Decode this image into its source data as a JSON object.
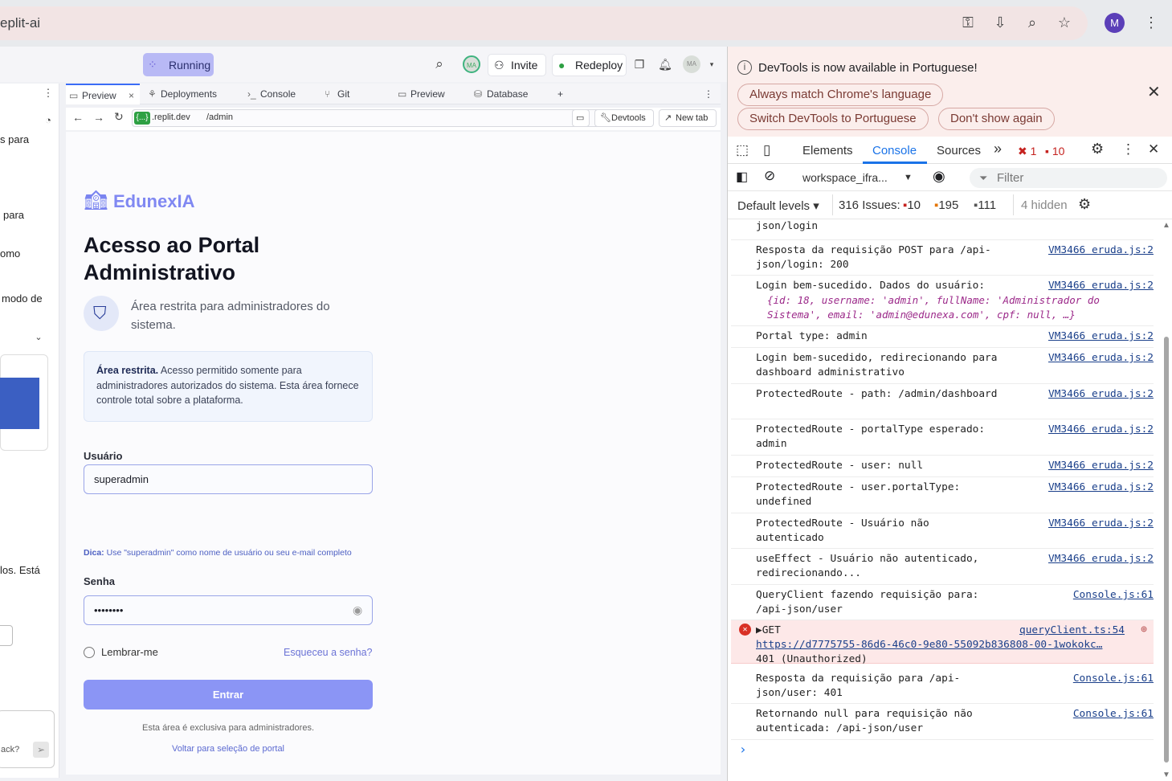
{
  "browser": {
    "url_fragment": "eplit-ai",
    "profile_initial": "M",
    "icons": [
      "key-icon",
      "install-icon",
      "zoom-icon",
      "star-icon",
      "menu-dots-icon"
    ]
  },
  "replit": {
    "status_label": "Running",
    "invite_label": "Invite",
    "redeploy_label": "Redeploy",
    "avatar_initials": "MA",
    "left_panel_fragments": [
      "s para",
      "para",
      "omo",
      "modo de",
      "los. Está",
      "ack?"
    ],
    "tabs": [
      {
        "label": "Preview"
      },
      {
        "label": "Deployments"
      },
      {
        "label": "Console"
      },
      {
        "label": "Git"
      },
      {
        "label": "Preview"
      },
      {
        "label": "Database"
      }
    ],
    "add_tab": "+",
    "url_domain_chip": "{...}",
    "url_domain": ".replit.dev",
    "url_path": "/admin",
    "devtools_btn": "Devtools",
    "newtab_btn": "New tab"
  },
  "app": {
    "brand": "EdunexIA",
    "title": "Acesso ao Portal Administrativo",
    "subtitle": "Área restrita para administradores do sistema.",
    "notice_bold": "Área restrita.",
    "notice_text": " Acesso permitido somente para administradores autorizados do sistema. Esta área fornece controle total sobre a plataforma.",
    "username_label": "Usuário",
    "username_value": "superadmin",
    "hint_bold": "Dica:",
    "hint_text": " Use \"superadmin\" como nome de usuário ou seu e-mail completo",
    "password_label": "Senha",
    "password_value": "••••••••",
    "remember_label": "Lembrar-me",
    "forgot_label": "Esqueceu a senha?",
    "submit_label": "Entrar",
    "footnote": "Esta área é exclusiva para administradores.",
    "back_link": "Voltar para seleção de portal"
  },
  "devtools": {
    "info_message": "DevTools is now available in Portuguese!",
    "btn_match": "Always match Chrome's language",
    "btn_switch": "Switch DevTools to Portuguese",
    "btn_dont": "Don't show again",
    "tab_elements": "Elements",
    "tab_console": "Console",
    "tab_sources": "Sources",
    "more_tabs": "»",
    "error_count": "1",
    "warn_count": "10",
    "context": "workspace_ifra...",
    "filter_placeholder": "Filter",
    "levels": "Default levels ▾",
    "issues_label": "316 Issues:",
    "issues_err": "10",
    "issues_warn": "195",
    "issues_info": "111",
    "hidden": "4 hidden",
    "logs": [
      {
        "text": "json/login",
        "src": ""
      },
      {
        "text": "Resposta da requisição POST para /api-json/login: 200",
        "src": "VM3466 eruda.js:2"
      },
      {
        "text": "Login bem-sucedido. Dados do usuário:",
        "src": "VM3466 eruda.js:2",
        "object": "{id: 18, username: 'admin', fullName: 'Administrador do Sistema', email: 'admin@edunexa.com', cpf: null, …}"
      },
      {
        "text": "Portal type: admin",
        "src": "VM3466 eruda.js:2"
      },
      {
        "text": "Login bem-sucedido, redirecionando para dashboard administrativo",
        "src": "VM3466 eruda.js:2"
      },
      {
        "text": "ProtectedRoute - path: /admin/dashboard",
        "src": "VM3466 eruda.js:2"
      },
      {
        "text": "ProtectedRoute - portalType esperado: admin",
        "src": "VM3466 eruda.js:2"
      },
      {
        "text": "ProtectedRoute - user: null",
        "src": "VM3466 eruda.js:2"
      },
      {
        "text": "ProtectedRoute - user.portalType: undefined",
        "src": "VM3466 eruda.js:2"
      },
      {
        "text": "ProtectedRoute - Usuário não autenticado",
        "src": "VM3466 eruda.js:2"
      },
      {
        "text": "useEffect - Usuário não autenticado, redirecionando...",
        "src": "VM3466 eruda.js:2"
      },
      {
        "text": "QueryClient fazendo requisição para: /api-json/user",
        "src": "Console.js:61"
      },
      {
        "text": "▶GET",
        "src": "queryClient.ts:54",
        "link": "https://d7775755-86d6-46c0-9e80-55092b836808-00-1wokokc…",
        "status": "401 (Unauthorized)"
      },
      {
        "text": "Resposta da requisição para /api-json/user: 401",
        "src": "Console.js:61"
      },
      {
        "text": "Retornando null para requisição não autenticada: /api-json/user",
        "src": "Console.js:61"
      }
    ],
    "prompt": "›"
  }
}
